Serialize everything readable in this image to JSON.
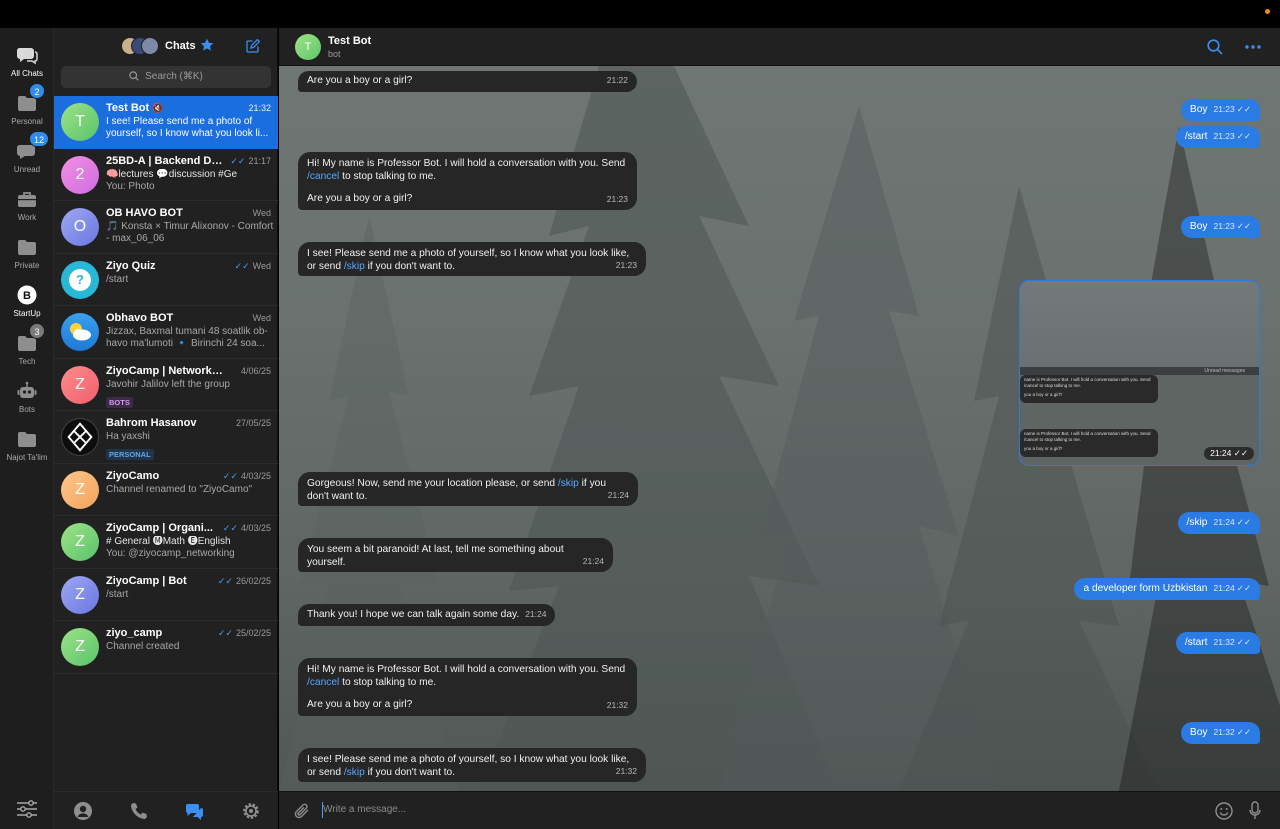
{
  "folders": [
    {
      "label": "All Chats",
      "icon": "chat-bubbles-icon",
      "badge": ""
    },
    {
      "label": "Personal",
      "icon": "folder-icon",
      "badge": "2"
    },
    {
      "label": "Unread",
      "icon": "chat-bubble-icon",
      "badge": "12"
    },
    {
      "label": "Work",
      "icon": "briefcase-icon",
      "badge": ""
    },
    {
      "label": "Private",
      "icon": "folder-icon",
      "badge": ""
    },
    {
      "label": "StartUp",
      "icon": "startup-b-icon",
      "badge": ""
    },
    {
      "label": "Tech",
      "icon": "folder-icon",
      "badge": "3"
    },
    {
      "label": "Bots",
      "icon": "robot-icon",
      "badge": ""
    },
    {
      "label": "Najot Ta'lim",
      "icon": "folder-icon",
      "badge": ""
    }
  ],
  "list": {
    "title": "Chats",
    "search_placeholder": "Search (⌘K)"
  },
  "chats": [
    {
      "name": "Test Bot",
      "time": "21:32",
      "tick": "",
      "preview": "I see! Please send me a photo of yourself, so I know what you look li...",
      "avatar": "T",
      "tag": ""
    },
    {
      "name": "25BD-A | Backend De...",
      "time": "21:17",
      "tick": "✓✓",
      "preview": "🧠lectures 💬discussion #Ge",
      "preview2": "You: Photo",
      "avatar": "2",
      "tag": ""
    },
    {
      "name": "OB HAVO BOT",
      "time": "Wed",
      "tick": "",
      "preview": "🎵 Konsta × Timur Alixonov - Comfort - max_06_06",
      "avatar": "O",
      "tag": ""
    },
    {
      "name": "Ziyo Quiz",
      "time": "Wed",
      "tick": "✓✓",
      "preview": "/start",
      "avatar": "?",
      "tag": ""
    },
    {
      "name": "Obhavo BOT",
      "time": "Wed",
      "tick": "",
      "preview": "Jizzax, Baxmal tumani 48 soatlik ob-havo ma'lumoti 🔹 Birinchi 24 soa...",
      "avatar": "",
      "tag": ""
    },
    {
      "name": "ZiyoCamp | Networking",
      "time": "4/06/25",
      "tick": "",
      "preview": "Javohir Jalilov left the group",
      "avatar": "Z",
      "tag": "BOTS"
    },
    {
      "name": "Bahrom Hasanov",
      "time": "27/05/25",
      "tick": "",
      "preview": "Ha yaxshi",
      "avatar": "",
      "tag": "PERSONAL"
    },
    {
      "name": "ZiyoCamo",
      "time": "4/03/25",
      "tick": "✓✓",
      "preview": "Channel renamed to \"ZiyoCamo\"",
      "avatar": "Z",
      "tag": ""
    },
    {
      "name": "ZiyoCamp | Organi...",
      "time": "4/03/25",
      "tick": "✓✓",
      "preview": "# General 🅜Math 🅔English",
      "preview2": "You: @ziyocamp_networking",
      "avatar": "Z",
      "tag": ""
    },
    {
      "name": "ZiyoCamp | Bot",
      "time": "26/02/25",
      "tick": "✓✓",
      "preview": "/start",
      "avatar": "Z",
      "tag": ""
    },
    {
      "name": "ziyo_camp",
      "time": "25/02/25",
      "tick": "✓✓",
      "preview": "Channel created",
      "avatar": "Z",
      "tag": ""
    }
  ],
  "header": {
    "title": "Test Bot",
    "subtitle": "bot",
    "avatar": "T"
  },
  "messages": {
    "m1": {
      "text": "Are you a boy or a girl?",
      "time": "21:22"
    },
    "m2": {
      "text": "Boy",
      "time": "21:23"
    },
    "m3": {
      "text": "/start",
      "time": "21:23"
    },
    "m4": {
      "line1_a": "Hi! My name is Professor Bot. I will hold a conversation with you. Send ",
      "line1_link": "/cancel",
      "line1_b": " to stop talking to me.",
      "line2": "Are you a boy or a girl?",
      "time": "21:23"
    },
    "m5": {
      "text": "Boy",
      "time": "21:23"
    },
    "m6": {
      "a": "I see! Please send me a photo of yourself, so I know what you look like, or send ",
      "link": "/skip",
      "b": " if you don't want to.",
      "time": "21:23"
    },
    "photo": {
      "time": "21:24",
      "bar": "Unread messages",
      "snip1": "name is Professor Bot. I will hold a conversation with you. Send /cancel to stop talking to me.",
      "snip1b": "you a boy or a girl?",
      "snip1t": "21:22",
      "snip2": "name is Professor Bot. I will hold a conversation with you. Send /cancel to stop talking to me.",
      "snip2b": "you a boy or a girl?",
      "snip2t": "21:23"
    },
    "m7": {
      "a": "Gorgeous! Now, send me your location please, or send ",
      "link": "/skip",
      "b": " if you don't want to.",
      "time": "21:24"
    },
    "m8": {
      "text": "/skip",
      "time": "21:24"
    },
    "m9": {
      "text": "You seem a bit paranoid! At last, tell me something about yourself.",
      "time": "21:24"
    },
    "m10": {
      "text": "a developer form Uzbkistan",
      "time": "21:24"
    },
    "m11": {
      "text": "Thank you! I hope we can talk again some day.",
      "time": "21:24"
    },
    "m12": {
      "text": "/start",
      "time": "21:32"
    },
    "m13": {
      "line1_a": "Hi! My name is Professor Bot. I will hold a conversation with you. Send ",
      "line1_link": "/cancel",
      "line1_b": " to stop talking to me.",
      "line2": "Are you a boy or a girl?",
      "time": "21:32"
    },
    "m14": {
      "text": "Boy",
      "time": "21:32"
    },
    "m15": {
      "a": "I see! Please send me a photo of yourself, so I know what you look like, or send ",
      "link": "/skip",
      "b": " if you don't want to.",
      "time": "21:32"
    }
  },
  "composer": {
    "placeholder": "Write a message..."
  },
  "colors": {
    "accent": "#2b7be4",
    "active_chat": "#1b6ede",
    "incoming": "#262626",
    "panel": "#212121"
  }
}
